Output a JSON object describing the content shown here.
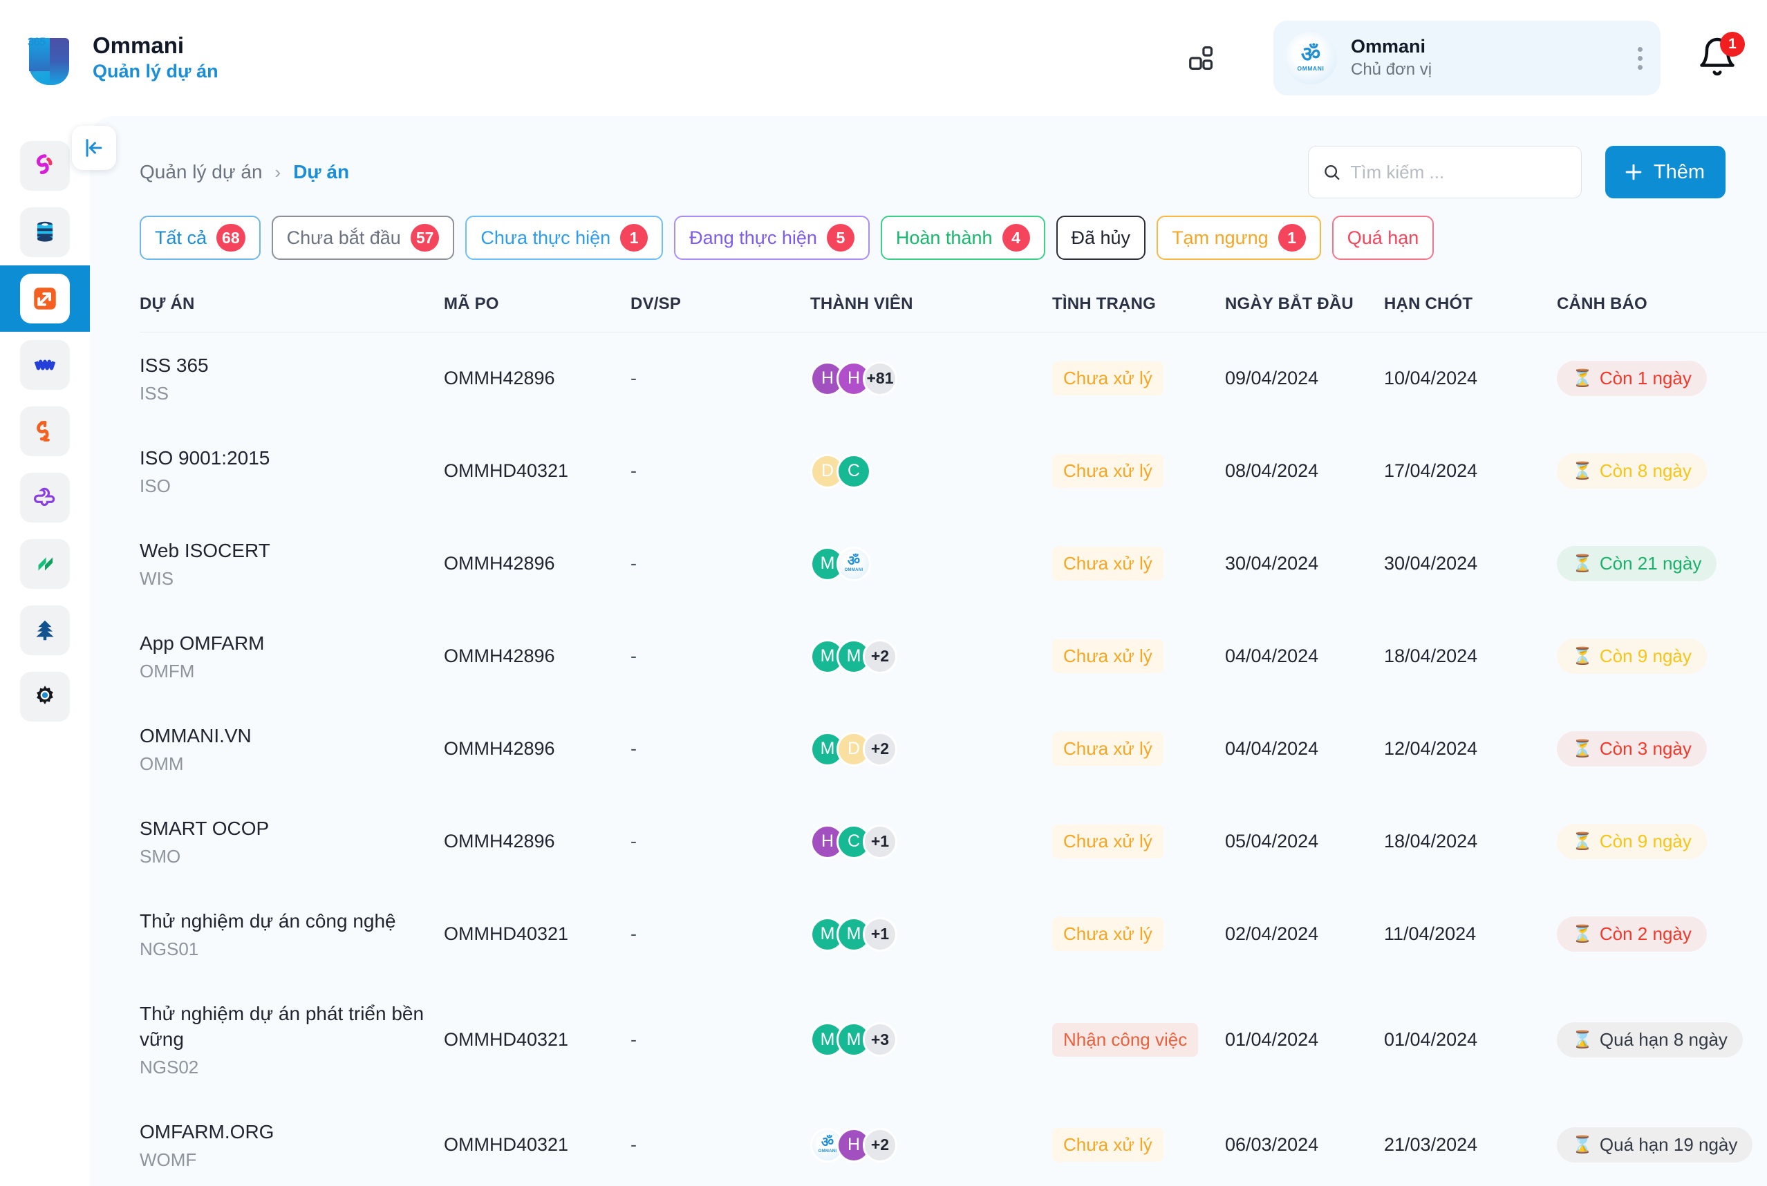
{
  "app": {
    "logo_number": "365",
    "name": "Ommani",
    "module": "Quản lý dự án"
  },
  "header": {
    "grid_icon": "apps-grid-icon",
    "org": {
      "avatar_glyph": "ॐ",
      "avatar_label": "OMMANI",
      "name": "Ommani",
      "role": "Chủ đơn vị",
      "more_icon": "more-vertical-icon"
    },
    "notification": {
      "icon": "bell-icon",
      "count": "1"
    }
  },
  "rail": {
    "items": [
      {
        "name": "sidebar-item-sync",
        "icon": "sync-icon",
        "active": false
      },
      {
        "name": "sidebar-item-database",
        "icon": "database-icon",
        "active": false
      },
      {
        "name": "sidebar-item-projects",
        "icon": "project-arrow-icon",
        "active": true
      },
      {
        "name": "sidebar-item-workflow",
        "icon": "workflow-icon",
        "active": false
      },
      {
        "name": "sidebar-item-loop",
        "icon": "loop-icon",
        "active": false
      },
      {
        "name": "sidebar-item-plus-flower",
        "icon": "plus-flower-icon",
        "active": false
      },
      {
        "name": "sidebar-item-layers",
        "icon": "layers-icon",
        "active": false
      },
      {
        "name": "sidebar-item-tree",
        "icon": "tree-icon",
        "active": false
      },
      {
        "name": "sidebar-item-settings",
        "icon": "gear-icon",
        "active": false
      }
    ],
    "collapse_icon": "collapse-left-icon"
  },
  "breadcrumb": {
    "parent": "Quản lý dự án",
    "separator": "›",
    "current": "Dự án"
  },
  "search": {
    "icon": "search-icon",
    "placeholder": "Tìm kiếm ...",
    "value": ""
  },
  "add_button": {
    "icon": "plus-icon",
    "label": "Thêm"
  },
  "filters": [
    {
      "label": "Tất cả",
      "count": "68",
      "color": "#1b8ed6",
      "border": "#6fb8e8",
      "active": true
    },
    {
      "label": "Chưa bắt đầu",
      "count": "57",
      "color": "#6b7280",
      "border": "#8b9099",
      "active": false
    },
    {
      "label": "Chưa thực hiện",
      "count": "1",
      "color": "#2c9cf0",
      "border": "#6cc0f5",
      "active": false
    },
    {
      "label": "Đang thực hiện",
      "count": "5",
      "color": "#7d5bf0",
      "border": "#a98ef5",
      "active": false
    },
    {
      "label": "Hoàn thành",
      "count": "4",
      "color": "#15b96b",
      "border": "#3bcf87",
      "active": false
    },
    {
      "label": "Đã hủy",
      "count": "",
      "color": "#1f2430",
      "border": "#2b3038",
      "active": false
    },
    {
      "label": "Tạm ngưng",
      "count": "1",
      "color": "#f5a623",
      "border": "#f7b941",
      "active": false
    },
    {
      "label": "Quá hạn",
      "count": "",
      "color": "#f4455c",
      "border": "#f4758a",
      "active": false
    }
  ],
  "table": {
    "columns": [
      "DỰ ÁN",
      "MÃ PO",
      "DV/SP",
      "THÀNH VIÊN",
      "TÌNH TRẠNG",
      "NGÀY BẮT ĐẦU",
      "HẠN CHÓT",
      "CẢNH BÁO"
    ],
    "rows": [
      {
        "project": "ISS 365",
        "code": "ISS",
        "po": "OMMH42896",
        "dvsp": "-",
        "members": [
          {
            "type": "letter",
            "text": "H",
            "color": "#a250c0"
          },
          {
            "type": "letter",
            "text": "H",
            "color": "#b14ec9"
          }
        ],
        "overflow": "+81",
        "status": "Chưa xử lý",
        "status_kind": "pending",
        "start": "09/04/2024",
        "due": "10/04/2024",
        "warning": "Còn 1 ngày",
        "warning_kind": "red",
        "warning_icon": "hourglass-icon"
      },
      {
        "project": "ISO 9001:2015",
        "code": "ISO",
        "po": "OMMHD40321",
        "dvsp": "-",
        "members": [
          {
            "type": "letter",
            "text": "D",
            "color": "#fae0a0"
          },
          {
            "type": "letter",
            "text": "C",
            "color": "#17b894"
          }
        ],
        "overflow": "",
        "status": "Chưa xử lý",
        "status_kind": "pending",
        "start": "08/04/2024",
        "due": "17/04/2024",
        "warning": "Còn 8 ngày",
        "warning_kind": "yellow",
        "warning_icon": "hourglass-icon"
      },
      {
        "project": "Web ISOCERT",
        "code": "WIS",
        "po": "OMMH42896",
        "dvsp": "-",
        "members": [
          {
            "type": "letter",
            "text": "M",
            "color": "#17b894"
          },
          {
            "type": "ommani",
            "text": "ॐ",
            "color": ""
          }
        ],
        "overflow": "",
        "status": "Chưa xử lý",
        "status_kind": "pending",
        "start": "30/04/2024",
        "due": "30/04/2024",
        "warning": "Còn 21 ngày",
        "warning_kind": "green",
        "warning_icon": "hourglass-icon"
      },
      {
        "project": "App OMFARM",
        "code": "OMFM",
        "po": "OMMH42896",
        "dvsp": "-",
        "members": [
          {
            "type": "letter",
            "text": "M",
            "color": "#17b894"
          },
          {
            "type": "letter",
            "text": "M",
            "color": "#17b894"
          }
        ],
        "overflow": "+2",
        "status": "Chưa xử lý",
        "status_kind": "pending",
        "start": "04/04/2024",
        "due": "18/04/2024",
        "warning": "Còn 9 ngày",
        "warning_kind": "yellow",
        "warning_icon": "hourglass-icon"
      },
      {
        "project": "OMMANI.VN",
        "code": "OMM",
        "po": "OMMH42896",
        "dvsp": "-",
        "members": [
          {
            "type": "letter",
            "text": "M",
            "color": "#17b894"
          },
          {
            "type": "letter",
            "text": "D",
            "color": "#fae0a0"
          }
        ],
        "overflow": "+2",
        "status": "Chưa xử lý",
        "status_kind": "pending",
        "start": "04/04/2024",
        "due": "12/04/2024",
        "warning": "Còn 3 ngày",
        "warning_kind": "red",
        "warning_icon": "hourglass-icon"
      },
      {
        "project": "SMART OCOP",
        "code": "SMO",
        "po": "OMMH42896",
        "dvsp": "-",
        "members": [
          {
            "type": "letter",
            "text": "H",
            "color": "#a250c0"
          },
          {
            "type": "letter",
            "text": "C",
            "color": "#17b894"
          }
        ],
        "overflow": "+1",
        "status": "Chưa xử lý",
        "status_kind": "pending",
        "start": "05/04/2024",
        "due": "18/04/2024",
        "warning": "Còn 9 ngày",
        "warning_kind": "yellow",
        "warning_icon": "hourglass-icon"
      },
      {
        "project": "Thử nghiệm dự án công nghệ",
        "code": "NGS01",
        "po": "OMMHD40321",
        "dvsp": "-",
        "members": [
          {
            "type": "letter",
            "text": "M",
            "color": "#17b894"
          },
          {
            "type": "letter",
            "text": "M",
            "color": "#17b894"
          }
        ],
        "overflow": "+1",
        "status": "Chưa xử lý",
        "status_kind": "pending",
        "start": "02/04/2024",
        "due": "11/04/2024",
        "warning": "Còn 2 ngày",
        "warning_kind": "red",
        "warning_icon": "hourglass-icon"
      },
      {
        "project": "Thử nghiệm dự án phát triển bền vững",
        "code": "NGS02",
        "po": "OMMHD40321",
        "dvsp": "-",
        "members": [
          {
            "type": "letter",
            "text": "M",
            "color": "#17b894"
          },
          {
            "type": "letter",
            "text": "M",
            "color": "#17b894"
          }
        ],
        "overflow": "+3",
        "status": "Nhận công việc",
        "status_kind": "accept",
        "start": "01/04/2024",
        "due": "01/04/2024",
        "warning": "Quá hạn 8 ngày",
        "warning_kind": "gray",
        "warning_icon": "hourglass-done-icon"
      },
      {
        "project": "OMFARM.ORG",
        "code": "WOMF",
        "po": "OMMHD40321",
        "dvsp": "-",
        "members": [
          {
            "type": "ommani",
            "text": "ॐ",
            "color": ""
          },
          {
            "type": "letter",
            "text": "H",
            "color": "#a250c0"
          }
        ],
        "overflow": "+2",
        "status": "Chưa xử lý",
        "status_kind": "pending",
        "start": "06/03/2024",
        "due": "21/03/2024",
        "warning": "Quá hạn 19 ngày",
        "warning_kind": "gray",
        "warning_icon": "hourglass-done-icon"
      }
    ]
  }
}
